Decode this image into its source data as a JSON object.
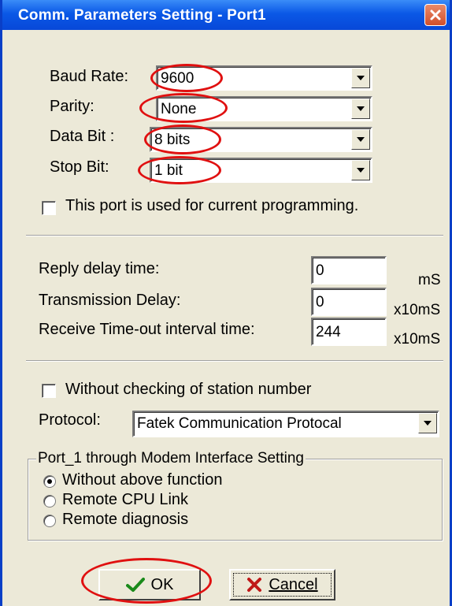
{
  "window": {
    "title": "Comm. Parameters Setting - Port1"
  },
  "serial": {
    "baud_rate": {
      "label": "Baud Rate:",
      "value": "9600"
    },
    "parity": {
      "label": "Parity:",
      "value": "None"
    },
    "data_bit": {
      "label": "Data Bit :",
      "value": "8 bits"
    },
    "stop_bit": {
      "label": "Stop Bit:",
      "value": "1 bit"
    },
    "current_programming": {
      "label": "This port is used for current programming.",
      "checked": false
    }
  },
  "timing": {
    "reply_delay": {
      "label": "Reply delay time:",
      "value": "0",
      "unit": "mS"
    },
    "transmission_delay": {
      "label": "Transmission Delay:",
      "value": "0",
      "unit": "x10mS"
    },
    "receive_timeout": {
      "label": "Receive Time-out interval time:",
      "value": "244",
      "unit": "x10mS"
    }
  },
  "station": {
    "without_checking": {
      "label": "Without checking of station number",
      "checked": false
    },
    "protocol": {
      "label": "Protocol:",
      "value": "Fatek Communication Protocal"
    }
  },
  "modem": {
    "title": "Port_1 through Modem Interface Setting",
    "options": [
      {
        "label": "Without above function",
        "selected": true
      },
      {
        "label": "Remote CPU Link",
        "selected": false
      },
      {
        "label": "Remote diagnosis",
        "selected": false
      }
    ]
  },
  "buttons": {
    "ok": "OK",
    "cancel": "Cancel"
  },
  "colors": {
    "highlight": "#e01010",
    "title_bar": "#0a58e6",
    "dialog_bg": "#ece9d8"
  }
}
